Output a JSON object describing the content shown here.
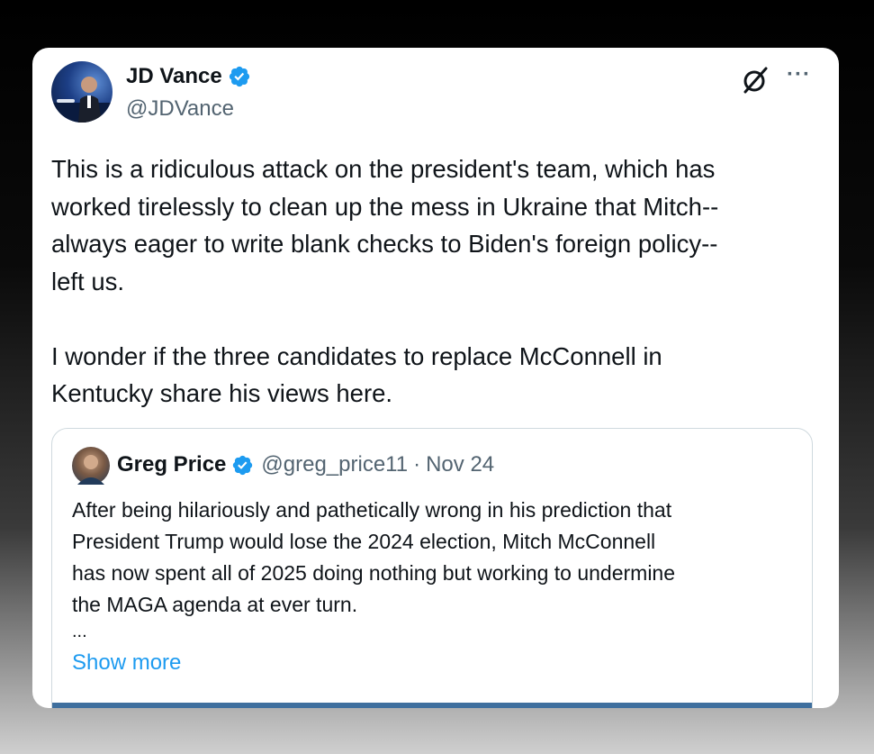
{
  "tweet": {
    "author_name": "JD Vance",
    "author_handle": "@JDVance",
    "text": "This is a ridiculous attack on the president's team, which has\nworked tirelessly to clean up the mess in Ukraine that Mitch--\nalways eager to write blank checks to Biden's foreign policy--\nleft us.\n\nI wonder if the three candidates to replace McConnell in\nKentucky share his views here.",
    "more_label": "···"
  },
  "quoted_tweet": {
    "author_name": "Greg Price",
    "author_handle": "@greg_price11",
    "separator": "·",
    "date": "Nov 24",
    "text": "After being hilariously and pathetically wrong in his prediction that\nPresident Trump would lose the 2024 election, Mitch McConnell\nhas now spent all of 2025 doing nothing but working to undermine\nthe MAGA agenda at ever turn.",
    "ellipsis": "...",
    "show_more_label": "Show more"
  },
  "icons": {
    "verified": "verified-badge-icon",
    "grok": "grok-icon",
    "more": "more-icon"
  },
  "colors": {
    "verified_blue": "#1d9bf0",
    "link_blue": "#1d9bf0",
    "text_primary": "#0f1419",
    "text_secondary": "#536471"
  }
}
